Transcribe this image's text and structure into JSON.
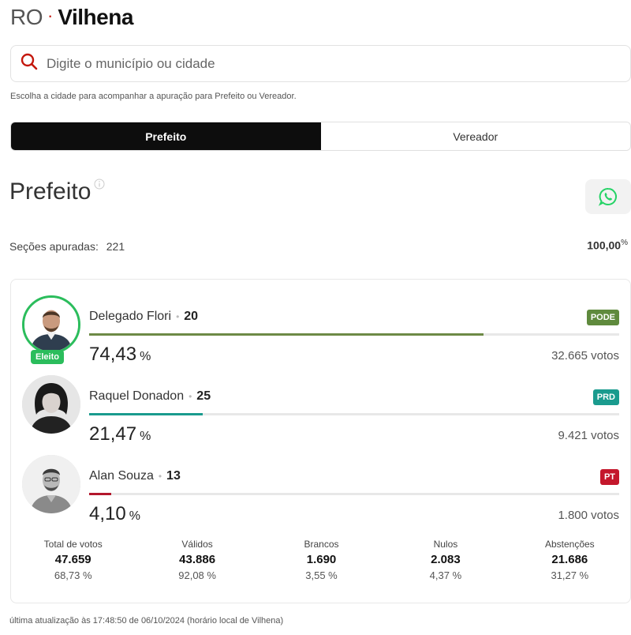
{
  "header": {
    "state": "RO",
    "separator": "·",
    "city": "Vilhena"
  },
  "search": {
    "placeholder": "Digite o município ou cidade",
    "icon": "search-icon",
    "icon_color": "#c4170c"
  },
  "hint": "Escolha a cidade para acompanhar a apuração para Prefeito ou Vereador.",
  "tabs": [
    {
      "label": "Prefeito",
      "active": true
    },
    {
      "label": "Vereador",
      "active": false
    }
  ],
  "section": {
    "title": "Prefeito",
    "info_icon": "info-icon",
    "share_icon": "whatsapp-icon",
    "share_color": "#25d366"
  },
  "progress": {
    "label": "Seções apuradas:",
    "sections": "221",
    "percent": "100,00",
    "percent_sign": "%"
  },
  "candidates": [
    {
      "name": "Delegado Flori",
      "number": "20",
      "party": "PODE",
      "party_color": "#5f8a3d",
      "bar_color": "#6d8a46",
      "percent": "74,43",
      "percent_value": 74.43,
      "unit": "%",
      "votes": "32.665 votos",
      "elected": true,
      "elected_label": "Eleito"
    },
    {
      "name": "Raquel Donadon",
      "number": "25",
      "party": "PRD",
      "party_color": "#1a9b8e",
      "bar_color": "#1a9b8e",
      "percent": "21,47",
      "percent_value": 21.47,
      "unit": "%",
      "votes": "9.421 votos",
      "elected": false
    },
    {
      "name": "Alan Souza",
      "number": "13",
      "party": "PT",
      "party_color": "#c4172c",
      "bar_color": "#b3172c",
      "percent": "4,10",
      "percent_value": 4.1,
      "unit": "%",
      "votes": "1.800 votos",
      "elected": false
    }
  ],
  "stats": [
    {
      "label": "Total de votos",
      "value": "47.659",
      "percent": "68,73 %"
    },
    {
      "label": "Válidos",
      "value": "43.886",
      "percent": "92,08 %"
    },
    {
      "label": "Brancos",
      "value": "1.690",
      "percent": "3,55 %"
    },
    {
      "label": "Nulos",
      "value": "2.083",
      "percent": "4,37 %"
    },
    {
      "label": "Abstenções",
      "value": "21.686",
      "percent": "31,27 %"
    }
  ],
  "footer": "última atualização às 17:48:50 de 06/10/2024 (horário local de Vilhena)"
}
